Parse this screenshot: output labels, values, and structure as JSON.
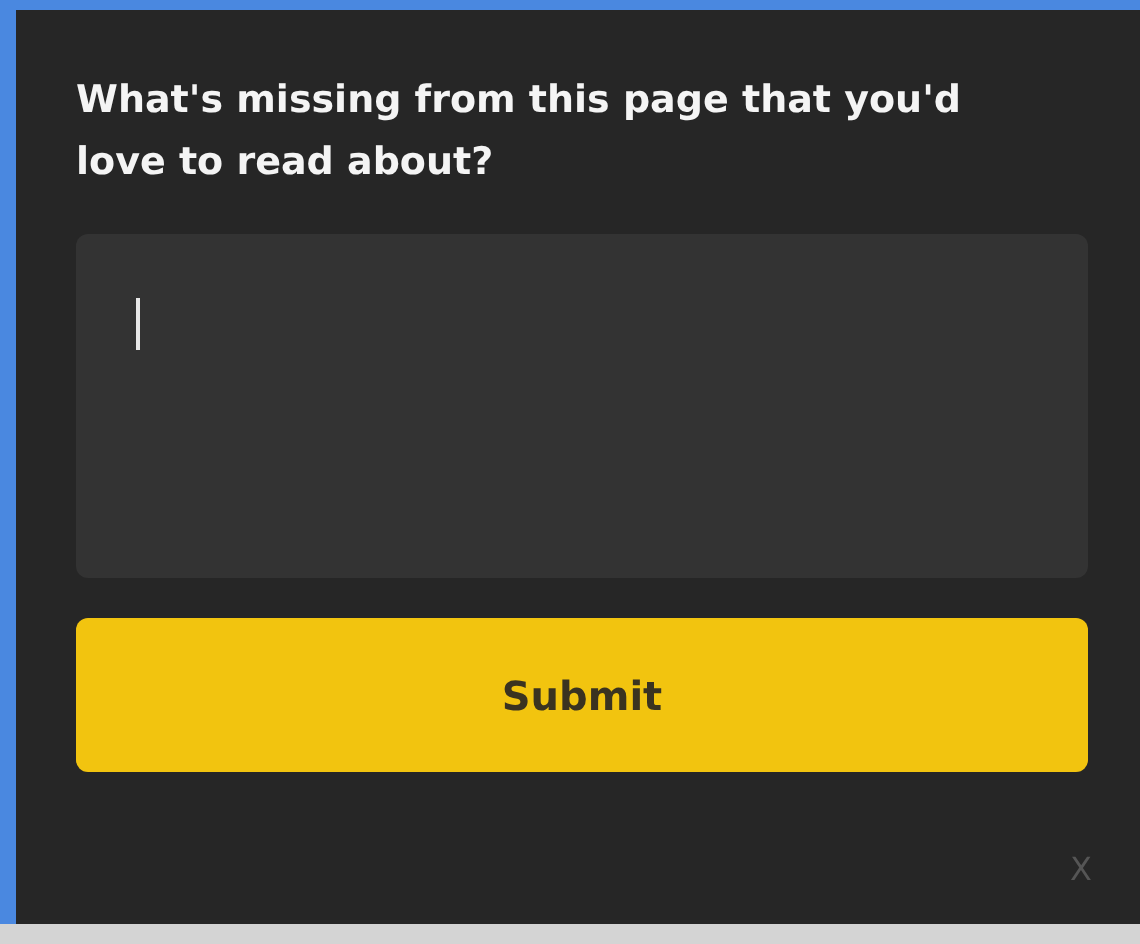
{
  "prompt": "What's missing from this page that you'd love to read about?",
  "submit": "Submit",
  "close": "X"
}
